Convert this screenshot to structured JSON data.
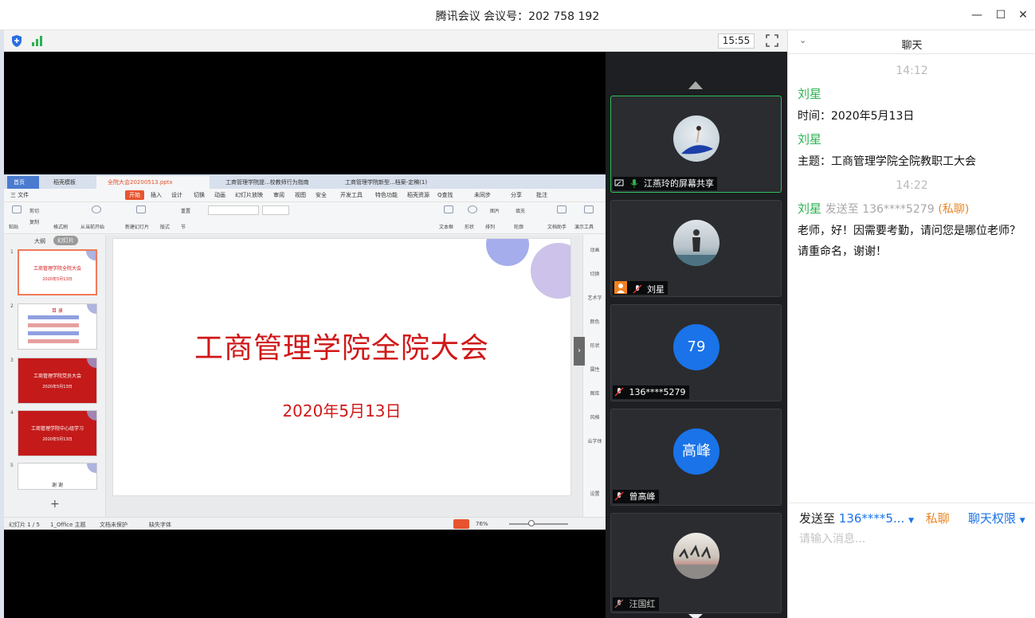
{
  "window": {
    "title": "腾讯会议 会议号：202 758 192",
    "minimize": "—",
    "maximize": "☐",
    "close": "✕"
  },
  "toolbar": {
    "clock": "15:55",
    "shield_icon": "shield-icon",
    "signal_icon": "signal-icon",
    "fullscreen_icon": "fullscreen-icon"
  },
  "wps": {
    "tabs": [
      "首页",
      "稻壳模板",
      "全院大会20200513.pptx",
      "工商管理学院提...校教师行为指南",
      "工商管理学院新型...档案-定稿(1)"
    ],
    "menus": [
      "三 文件",
      "开始",
      "插入",
      "设计",
      "切换",
      "动画",
      "幻灯片放映",
      "审阅",
      "视图",
      "安全",
      "开发工具",
      "特色功能",
      "稻壳资源",
      "Q查找",
      "未同步",
      "分享",
      "批注"
    ],
    "ribbon_labels": [
      "粘贴",
      "剪切",
      "复制",
      "格式刷",
      "从当前开始",
      "新建幻灯片",
      "版式",
      "节",
      "重置",
      "文本框",
      "形状",
      "排列",
      "图片",
      "轮廓",
      "填充",
      "文档助手",
      "演示工具"
    ],
    "thumb_panel_tabs": [
      "大纲",
      "幻灯片"
    ],
    "thumbs": [
      {
        "num": "1",
        "text": "工商管理学院全院大会",
        "sub": "2020年5月13日"
      },
      {
        "num": "2",
        "text": "目 录",
        "sub": ""
      },
      {
        "num": "3",
        "text": "工商管理学院党员大会",
        "sub": "2020年5月13日"
      },
      {
        "num": "4",
        "text": "工商管理学院中心组学习",
        "sub": "2020年5月13日"
      },
      {
        "num": "5",
        "text": "谢 谢",
        "sub": ""
      }
    ],
    "slide": {
      "title": "工商管理学院全院大会",
      "date": "2020年5月13日"
    },
    "side_tools": [
      "动画",
      "切换",
      "艺术字",
      "颜色",
      "形状",
      "属性",
      "图库",
      "风格",
      "云字体",
      "设置"
    ],
    "status": {
      "slide_count": "幻灯片 1 / 5",
      "theme": "1_Office 主题",
      "protect": "文档未保护",
      "missing_font": "缺失字体",
      "zoom": "76%"
    }
  },
  "videos": [
    {
      "name": "江燕玲的屏幕共享",
      "avatar_type": "photo-dancer",
      "share": true
    },
    {
      "name": "刘星",
      "avatar_type": "photo-person"
    },
    {
      "name": "136****5279",
      "avatar_text": "79",
      "avatar_color": "#1a73e8"
    },
    {
      "name": "曾高峰",
      "avatar_text": "高峰",
      "avatar_color": "#1a73e8"
    },
    {
      "name": "汪国红",
      "avatar_type": "photo-group"
    }
  ],
  "chat": {
    "title": "聊天",
    "messages": [
      {
        "time": "14:12"
      },
      {
        "sender": "刘星",
        "text": "时间：2020年5月13日"
      },
      {
        "sender": "刘星",
        "text": "主题：工商管理学院全院教职工大会"
      },
      {
        "time": "14:22"
      },
      {
        "sender": "刘星",
        "sent_to": "发送至 136****5279",
        "private": "(私聊)",
        "text": "老师，好！因需要考勤，请问您是哪位老师？",
        "text2": "请重命名，谢谢！"
      }
    ],
    "footer": {
      "send_to_label": "发送至",
      "send_to_target": "136****5...",
      "private_label": "私聊",
      "permission_label": "聊天权限",
      "input_placeholder": "请输入消息..."
    }
  }
}
